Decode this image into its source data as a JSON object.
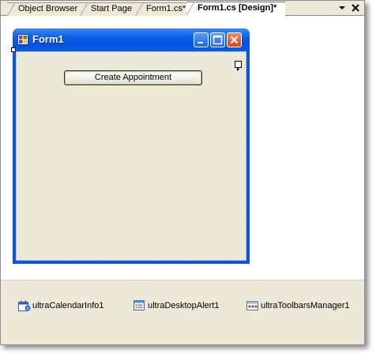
{
  "tabs": [
    {
      "label": "Object Browser"
    },
    {
      "label": "Start Page"
    },
    {
      "label": "Form1.cs*"
    },
    {
      "label": "Form1.cs [Design]*",
      "active": true
    }
  ],
  "tab_strip": {
    "dropdown_icon": "dropdown-arrow-icon",
    "close_icon": "close-icon"
  },
  "form": {
    "title": "Form1",
    "button_label": "Create Appointment"
  },
  "component_tray": {
    "items": [
      {
        "label": "ultraCalendarInfo1",
        "icon": "calendar-info-icon"
      },
      {
        "label": "ultraDesktopAlert1",
        "icon": "desktop-alert-icon"
      },
      {
        "label": "ultraToolbarsManager1",
        "icon": "toolbars-manager-icon"
      }
    ]
  },
  "colors": {
    "title_bar": "#0a5ee9",
    "form_client": "#ece9d8",
    "tray": "#ece9d8"
  }
}
